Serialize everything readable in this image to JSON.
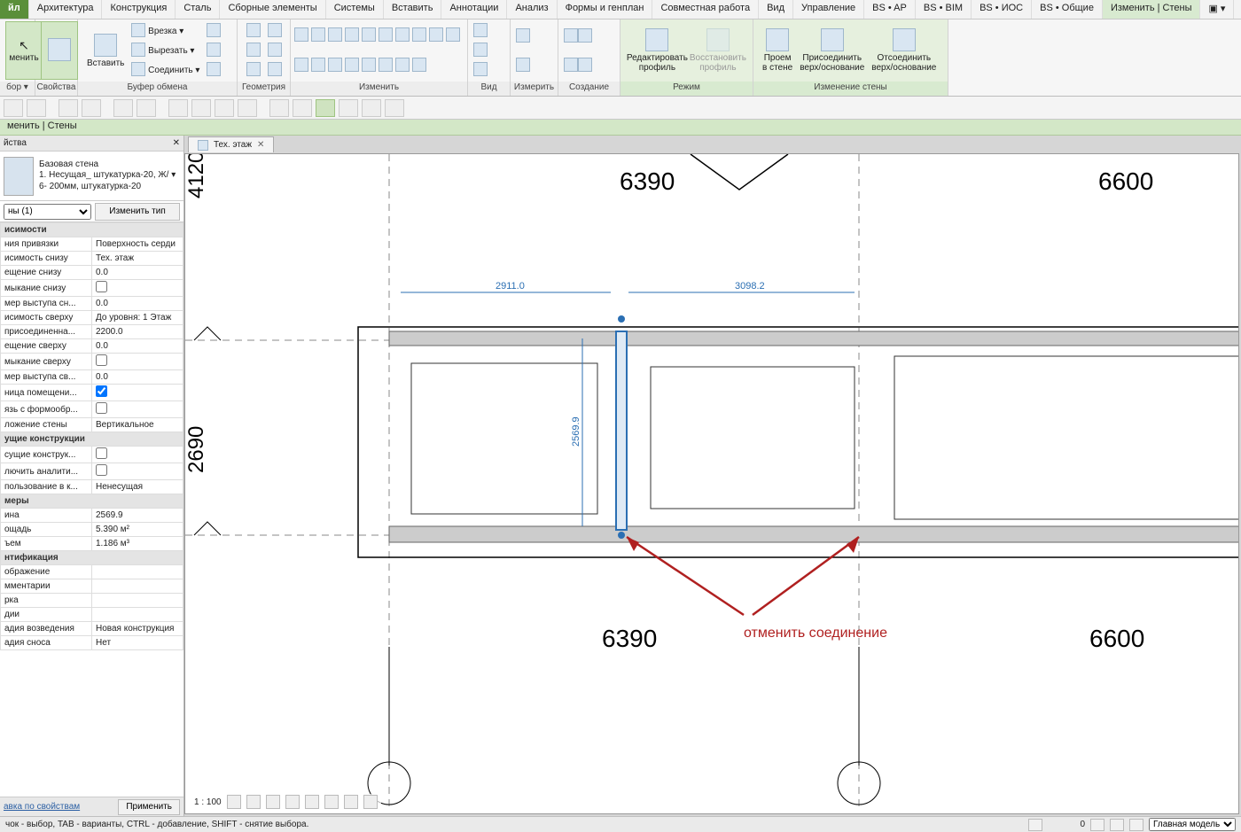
{
  "menu": {
    "file": "йл",
    "items": [
      "Архитектура",
      "Конструкция",
      "Сталь",
      "Сборные элементы",
      "Системы",
      "Вставить",
      "Аннотации",
      "Анализ",
      "Формы и генплан",
      "Совместная работа",
      "Вид",
      "Управление",
      "BS • AP",
      "BS • BIM",
      "BS • ИОС",
      "BS • Общие"
    ],
    "active": "Изменить | Стены"
  },
  "ribbon": {
    "select": {
      "label": "бор ▾",
      "btn": "менить"
    },
    "props": {
      "label": "Свойства"
    },
    "paste": {
      "label": "Буфер обмена",
      "paste": "Вставить",
      "cut": "Вырезать ▾",
      "trim": "Врезка ▾",
      "join": "Соединить ▾"
    },
    "geometry": {
      "label": "Геометрия"
    },
    "modify": {
      "label": "Изменить"
    },
    "view": {
      "label": "Вид"
    },
    "measure": {
      "label": "Измерить"
    },
    "create": {
      "label": "Создание"
    },
    "mode": {
      "label": "Режим",
      "edit_profile": "Редактировать\nпрофиль",
      "reset_profile": "Восстановить\nпрофиль"
    },
    "wall_mod": {
      "label": "Изменение стены",
      "opening": "Проем\nв стене",
      "attach": "Присоединить\nверх/основание",
      "detach": "Отсоединить\nверх/основание"
    }
  },
  "context_band": "менить | Стены",
  "props_panel": {
    "title": "йства",
    "type_name": "Базовая стена",
    "type_desc": "1. Несущая_ штукатурка-20, Ж/ ▾\n6- 200мм,  штукатурка-20",
    "filter": "ны (1)",
    "edit_type": "Изменить тип",
    "sections": {
      "deps": "исимости",
      "struct": "ущие конструкции",
      "dims": "меры",
      "ident": "нтификация"
    },
    "rows": [
      [
        "ния привязки",
        "Поверхность серди"
      ],
      [
        "исимость снизу",
        "Тех. этаж"
      ],
      [
        "ещение снизу",
        "0.0"
      ],
      [
        "мыкание снизу",
        ""
      ],
      [
        "мер выступа сн...",
        "0.0"
      ],
      [
        "исимость сверху",
        "До уровня: 1 Этаж"
      ],
      [
        "присоединенна...",
        "2200.0"
      ],
      [
        "ещение сверху",
        "0.0"
      ],
      [
        "мыкание сверху",
        ""
      ],
      [
        "мер выступа св...",
        "0.0"
      ],
      [
        "ница помещени...",
        "checked"
      ],
      [
        "язь с формообр...",
        ""
      ],
      [
        "ложение стены",
        "Вертикальное"
      ]
    ],
    "struct_rows": [
      [
        "сущие конструк...",
        ""
      ],
      [
        "лючить аналити...",
        ""
      ],
      [
        "пользование в к...",
        "Ненесущая"
      ]
    ],
    "dim_rows": [
      [
        "ина",
        "2569.9"
      ],
      [
        "ощадь",
        "5.390 м²"
      ],
      [
        "ъем",
        "1.186 м³"
      ]
    ],
    "ident_rows": [
      [
        "ображение",
        ""
      ],
      [
        "мментарии",
        ""
      ],
      [
        "рка",
        ""
      ],
      [
        "дии",
        ""
      ],
      [
        "адия возведения",
        "Новая конструкция"
      ],
      [
        "адия сноса",
        "Нет"
      ]
    ],
    "help_link": "авка по свойствам",
    "apply": "Применить"
  },
  "view_tab": {
    "label": "Тех. этаж"
  },
  "canvas": {
    "dim_top1": "6390",
    "dim_top2": "6600",
    "dim_bot1": "6390",
    "dim_bot2": "6600",
    "dim_left_upper": "4120",
    "dim_left_lower": "2690",
    "temp_dim1": "2911.0",
    "temp_dim2": "3098.2",
    "temp_dim_v": "2569.9",
    "annotation": "отменить соединение"
  },
  "view_ctrl": {
    "scale": "1 : 100"
  },
  "status": {
    "msg": "чок - выбор, TAB - варианты, CTRL - добавление, SHIFT - снятие выбора.",
    "zoom": "0",
    "model": "Главная модель"
  }
}
